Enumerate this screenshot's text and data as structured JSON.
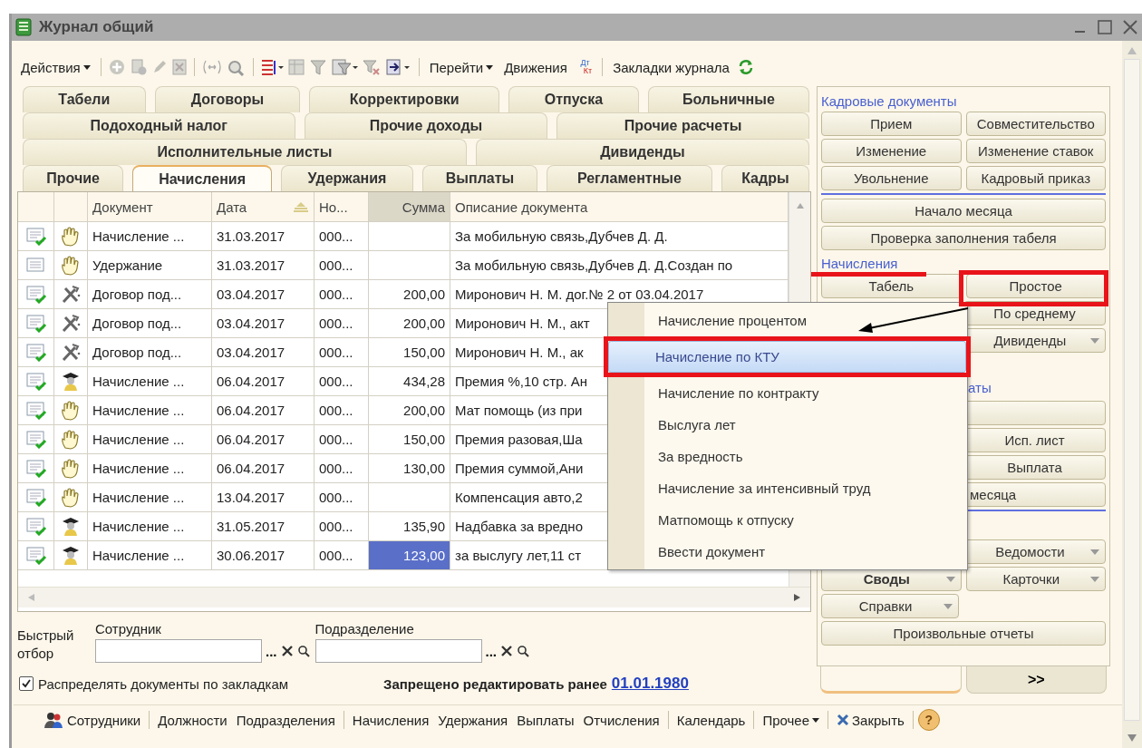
{
  "window": {
    "title": "Журнал общий"
  },
  "toolbar": {
    "items": [
      {
        "label": "Действия",
        "dropdown": true
      },
      {
        "label": "Перейти",
        "dropdown": true
      },
      {
        "label": "Движения",
        "dropdown": false
      },
      {
        "label": "Закладки журнала",
        "dropdown": false
      }
    ],
    "dt": "Дт",
    "kt": "Кт"
  },
  "tabs": [
    [
      {
        "label": "Табели",
        "selected": false
      },
      {
        "label": "Договоры",
        "selected": false
      },
      {
        "label": "Корректировки",
        "selected": false
      },
      {
        "label": "Отпуска",
        "selected": false
      },
      {
        "label": "Больничные",
        "selected": false
      }
    ],
    [
      {
        "label": "Подоходный налог",
        "selected": false
      },
      {
        "label": "Прочие доходы",
        "selected": false
      },
      {
        "label": "Прочие расчеты",
        "selected": false
      }
    ],
    [
      {
        "label": "Исполнительные листы",
        "selected": false
      },
      {
        "label": "Дивиденды",
        "selected": false
      }
    ],
    [
      {
        "label": "Прочие",
        "selected": false
      },
      {
        "label": "Начисления",
        "selected": true
      },
      {
        "label": "Удержания",
        "selected": false
      },
      {
        "label": "Выплаты",
        "selected": false
      },
      {
        "label": "Регламентные",
        "selected": false
      },
      {
        "label": "Кадры",
        "selected": false
      }
    ]
  ],
  "table": {
    "columns": [
      {
        "label": "Документ",
        "sorted": false,
        "current": false
      },
      {
        "label": "Дата",
        "sorted": true,
        "current": false
      },
      {
        "label": "Но...",
        "sorted": false,
        "current": false
      },
      {
        "label": "Сумма",
        "sorted": false,
        "current": true
      },
      {
        "label": "Описание документа",
        "sorted": false,
        "current": false
      }
    ],
    "rows": [
      {
        "posted": true,
        "kind": "hand",
        "document": "Начисление ...",
        "date": "31.03.2017",
        "number": "000...",
        "sum": "",
        "description": "За мобильную связь,Дубчев Д. Д.",
        "selected": false
      },
      {
        "posted": false,
        "kind": "hand",
        "document": "Удержание",
        "date": "31.03.2017",
        "number": "000...",
        "sum": "",
        "description": "За мобильную связь,Дубчев Д. Д.Создан по",
        "selected": false
      },
      {
        "posted": true,
        "kind": "tools",
        "document": "Договор под...",
        "date": "03.04.2017",
        "number": "000...",
        "sum": "200,00",
        "description": "Миронович Н. М. дог.№ 2 от 03.04.2017",
        "selected": false
      },
      {
        "posted": true,
        "kind": "tools",
        "document": "Договор под...",
        "date": "03.04.2017",
        "number": "000...",
        "sum": "200,00",
        "description": "Миронович Н. М., акт",
        "selected": false
      },
      {
        "posted": true,
        "kind": "tools",
        "document": "Договор под...",
        "date": "03.04.2017",
        "number": "000...",
        "sum": "150,00",
        "description": "Миронович Н. М., ак",
        "selected": false
      },
      {
        "posted": true,
        "kind": "graduate",
        "document": "Начисление ...",
        "date": "06.04.2017",
        "number": "000...",
        "sum": "434,28",
        "description": "Премия %,10 стр. Ан",
        "selected": false
      },
      {
        "posted": true,
        "kind": "hand",
        "document": "Начисление ...",
        "date": "06.04.2017",
        "number": "000...",
        "sum": "200,00",
        "description": "Мат помощь (из при",
        "selected": false
      },
      {
        "posted": true,
        "kind": "hand",
        "document": "Начисление ...",
        "date": "06.04.2017",
        "number": "000...",
        "sum": "150,00",
        "description": "Премия разовая,Ша",
        "selected": false
      },
      {
        "posted": true,
        "kind": "hand",
        "document": "Начисление ...",
        "date": "06.04.2017",
        "number": "000...",
        "sum": "130,00",
        "description": "Премия суммой,Ани",
        "selected": false
      },
      {
        "posted": true,
        "kind": "hand",
        "document": "Начисление ...",
        "date": "13.04.2017",
        "number": "000...",
        "sum": "",
        "description": "Компенсация авто,2",
        "selected": false
      },
      {
        "posted": true,
        "kind": "graduate",
        "document": "Начисление ...",
        "date": "31.05.2017",
        "number": "000...",
        "sum": "135,90",
        "description": "Надбавка за вредно",
        "selected": false
      },
      {
        "posted": true,
        "kind": "graduate",
        "document": "Начисление ...",
        "date": "30.06.2017",
        "number": "000...",
        "sum": "123,00",
        "description": "за выслугу лет,11 ст",
        "selected": true
      }
    ]
  },
  "filter": {
    "label": "Быстрый отбор",
    "fields": [
      {
        "label": "Сотрудник",
        "more": "..."
      },
      {
        "label": "Подразделение",
        "more": "..."
      }
    ]
  },
  "distribute": {
    "label": "Распределять документы по закладкам",
    "checked": true
  },
  "lock": {
    "label": "Запрещено редактировать ранее",
    "date": "01.01.1980"
  },
  "panel": {
    "rows": [
      {
        "kind": "label",
        "text": "Кадровые документы",
        "underlined": false
      },
      {
        "kind": "pair",
        "buttons": [
          {
            "label": "Прием",
            "dropdown": false,
            "bold": false
          },
          {
            "label": "Совместительство",
            "dropdown": false,
            "bold": false
          }
        ],
        "underlined": false
      },
      {
        "kind": "pair",
        "buttons": [
          {
            "label": "Изменение",
            "dropdown": false,
            "bold": false
          },
          {
            "label": "Изменение ставок",
            "dropdown": false,
            "bold": false
          }
        ],
        "underlined": false
      },
      {
        "kind": "pair",
        "buttons": [
          {
            "label": "Увольнение",
            "dropdown": false,
            "bold": false
          },
          {
            "label": "Кадровый приказ",
            "dropdown": false,
            "bold": false
          }
        ],
        "underlined": true
      },
      {
        "kind": "full",
        "buttons": [
          {
            "label": "Начало месяца",
            "dropdown": false,
            "bold": false
          }
        ],
        "underlined": false
      },
      {
        "kind": "full",
        "buttons": [
          {
            "label": "Проверка заполнения табеля",
            "dropdown": false,
            "bold": false
          }
        ],
        "underlined": false
      },
      {
        "kind": "label",
        "text": "Начисления",
        "underlined": false
      },
      {
        "kind": "pair",
        "buttons": [
          {
            "label": "Табель",
            "dropdown": false,
            "bold": false
          },
          {
            "label": "Простое",
            "dropdown": false,
            "bold": false
          }
        ],
        "underlined": false
      },
      {
        "kind": "right",
        "buttons": [
          {
            "label": "По среднему",
            "dropdown": false,
            "bold": false
          }
        ],
        "underlined": false
      },
      {
        "kind": "right",
        "buttons": [
          {
            "label": "Дивиденды",
            "dropdown": true,
            "bold": false
          }
        ],
        "underlined": false
      },
      {
        "kind": "gap",
        "underlined": false
      },
      {
        "kind": "right_label",
        "text": "аты",
        "underlined": false
      },
      {
        "kind": "covered",
        "buttons": [
          {
            "dropdown": false
          }
        ],
        "underlined": false
      },
      {
        "kind": "right",
        "buttons": [
          {
            "label": "Исп. лист",
            "dropdown": false,
            "bold": false
          }
        ],
        "underlined": false
      },
      {
        "kind": "right",
        "buttons": [
          {
            "label": "Выплата",
            "dropdown": false,
            "bold": false
          }
        ],
        "underlined": false
      },
      {
        "kind": "covered",
        "buttons": [
          {
            "label": "месяца",
            "dropdown": false,
            "bold": false
          }
        ],
        "underlined": true
      },
      {
        "kind": "gap",
        "underlined": false
      },
      {
        "kind": "right",
        "buttons": [
          {
            "label": "Ведомости",
            "dropdown": true,
            "bold": false
          }
        ],
        "underlined": false
      },
      {
        "kind": "pair",
        "buttons": [
          {
            "label": "Своды",
            "dropdown": true,
            "bold": true
          },
          {
            "label": "Карточки",
            "dropdown": true,
            "bold": false
          }
        ],
        "underlined": false
      },
      {
        "kind": "left",
        "buttons": [
          {
            "label": "Справки",
            "dropdown": true,
            "bold": false
          }
        ],
        "underlined": false
      },
      {
        "kind": "full",
        "buttons": [
          {
            "label": "Произвольные отчеты",
            "dropdown": false,
            "bold": false
          }
        ],
        "underlined": false
      }
    ],
    "tabs": [
      {
        "selected": true
      },
      {
        "label": ">>",
        "selected": false
      }
    ]
  },
  "menu": {
    "items": [
      {
        "label": "Начисление процентом",
        "selected": false
      },
      {
        "label": "Начисление по КТУ",
        "selected": true
      },
      {
        "label": "Начисление по контракту",
        "selected": false
      },
      {
        "label": "Выслуга лет",
        "selected": false
      },
      {
        "label": "За вредность",
        "selected": false
      },
      {
        "label": "Начисление за интенсивный труд",
        "selected": false
      },
      {
        "label": "Матпомощь к отпуску",
        "selected": false
      },
      {
        "label": "Ввести документ",
        "selected": false
      }
    ]
  },
  "bottom_bar": {
    "groups": [
      [
        {
          "label": "Сотрудники",
          "kind": "people",
          "dropdown": false
        }
      ],
      [
        {
          "label": "Должности",
          "kind": "text",
          "dropdown": false
        },
        {
          "label": "Подразделения",
          "kind": "text",
          "dropdown": false
        }
      ],
      [
        {
          "label": "Начисления",
          "kind": "text",
          "dropdown": false
        },
        {
          "label": "Удержания",
          "kind": "text",
          "dropdown": false
        },
        {
          "label": "Выплаты",
          "kind": "text",
          "dropdown": false
        },
        {
          "label": "Отчисления",
          "kind": "text",
          "dropdown": false
        }
      ],
      [
        {
          "label": "Календарь",
          "kind": "text",
          "dropdown": false
        }
      ],
      [
        {
          "label": "Прочее",
          "kind": "text",
          "dropdown": true
        }
      ],
      [
        {
          "label": "Закрыть",
          "kind": "close",
          "dropdown": false
        }
      ]
    ],
    "help": "?"
  }
}
